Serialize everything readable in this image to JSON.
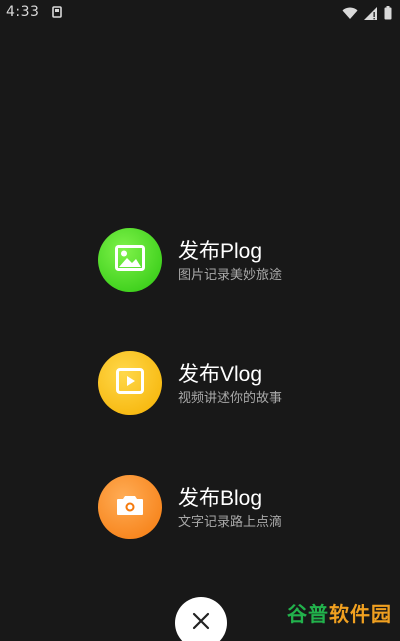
{
  "status_bar": {
    "time": "4:33",
    "notification_icon": "notification-icon",
    "wifi_icon": "wifi-icon",
    "signal_icon": "signal-icon",
    "battery_icon": "battery-icon"
  },
  "menu": {
    "items": [
      {
        "title": "发布Plog",
        "subtitle": "图片记录美妙旅途",
        "icon": "image-icon",
        "color": "#2bc60f"
      },
      {
        "title": "发布Vlog",
        "subtitle": "视频讲述你的故事",
        "icon": "play-icon",
        "color": "#f5b000"
      },
      {
        "title": "发布Blog",
        "subtitle": "文字记录路上点滴",
        "icon": "camera-icon",
        "color": "#f57a0d"
      }
    ]
  },
  "close_button": {
    "icon": "close-icon"
  },
  "watermark": {
    "part1": "谷普",
    "part2": "软件园"
  }
}
